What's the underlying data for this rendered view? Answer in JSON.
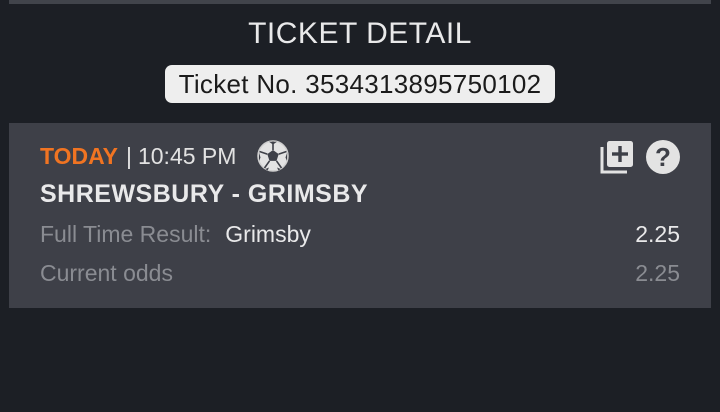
{
  "header": {
    "title": "TICKET DETAIL",
    "ticket_label": "Ticket No. 3534313895750102"
  },
  "bet": {
    "day": "TODAY",
    "separator": "|",
    "time": "10:45 PM",
    "sport_icon": "soccer-ball-icon",
    "match": "SHREWSBURY - GRIMSBY",
    "market_label": "Full Time Result:",
    "selection": "Grimsby",
    "odds": "2.25",
    "current_odds_label": "Current odds",
    "current_odds": "2.25",
    "actions": {
      "add_icon": "add-to-betslip-icon",
      "help_icon": "help-icon",
      "help_glyph": "?"
    }
  },
  "colors": {
    "background": "#1c1f25",
    "card": "#3e4048",
    "accent_today": "#f07422",
    "text_primary": "#e9e9ea",
    "text_muted": "#8a8c92"
  }
}
